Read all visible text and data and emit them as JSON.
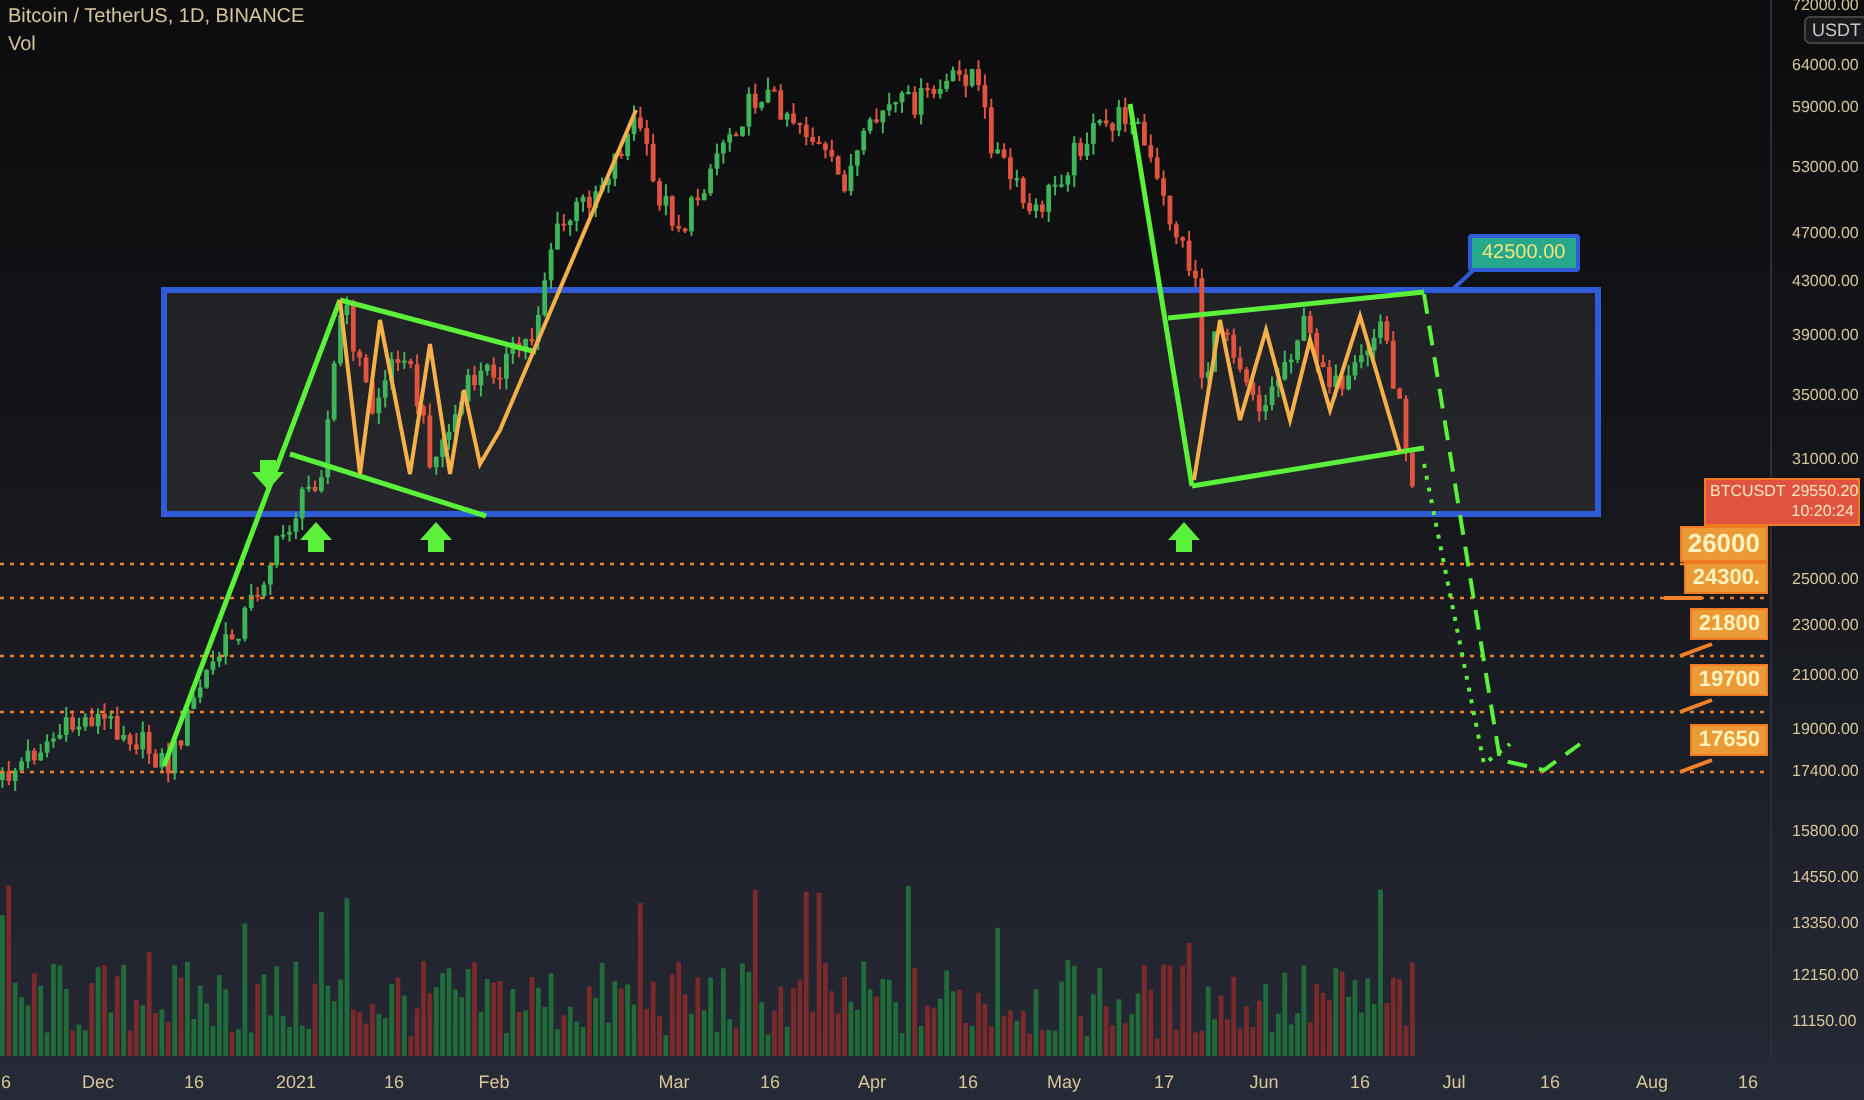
{
  "header": {
    "symbol": "Bitcoin / TetherUS, 1D, BINANCE",
    "indicator": "Vol"
  },
  "price_axis": {
    "currency": "USDT",
    "labels": [
      "72000.00",
      "64000.00",
      "59000.00",
      "53000.00",
      "47000.00",
      "43000.00",
      "39000.00",
      "35000.00",
      "31000.00",
      "25000.00",
      "23000.00",
      "21000.00",
      "19000.00",
      "17400.00",
      "15800.00",
      "14550.00",
      "13350.00",
      "12150.00",
      "11150.00"
    ]
  },
  "time_axis": {
    "labels": [
      "6",
      "Dec",
      "16",
      "2021",
      "16",
      "Feb",
      "Mar",
      "16",
      "Apr",
      "16",
      "May",
      "17",
      "Jun",
      "16",
      "Jul",
      "16",
      "Aug",
      "16"
    ]
  },
  "last_price": {
    "symbol": "BTCUSDT",
    "price": "29550.20",
    "countdown": "10:20:24"
  },
  "annotations": [
    {
      "kind": "target",
      "text": "42500.00"
    },
    {
      "kind": "level",
      "text": "26000"
    },
    {
      "kind": "level",
      "text": "24300."
    },
    {
      "kind": "level",
      "text": "21800"
    },
    {
      "kind": "level",
      "text": "19700"
    },
    {
      "kind": "level",
      "text": "17650"
    }
  ]
}
